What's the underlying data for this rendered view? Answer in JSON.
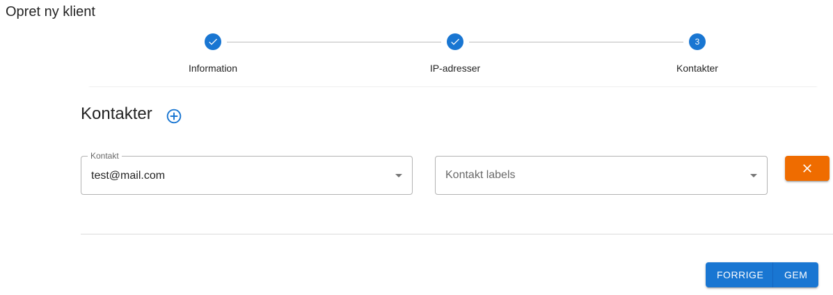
{
  "page": {
    "title": "Opret ny klient"
  },
  "stepper": {
    "steps": [
      {
        "label": "Information",
        "status": "completed",
        "icon": "check-icon"
      },
      {
        "label": "IP-adresser",
        "status": "completed",
        "icon": "check-icon"
      },
      {
        "label": "Kontakter",
        "status": "active",
        "number": "3"
      }
    ]
  },
  "contacts": {
    "title": "Kontakter",
    "add_icon": "add-circle-icon",
    "row": {
      "contact_label": "Kontakt",
      "contact_value": "test@mail.com",
      "labels_placeholder": "Kontakt labels",
      "remove_icon": "close-icon"
    }
  },
  "footer": {
    "prev_label": "FORRIGE",
    "save_label": "GEM"
  },
  "colors": {
    "primary": "#1976d2",
    "danger": "#ef6c00"
  }
}
